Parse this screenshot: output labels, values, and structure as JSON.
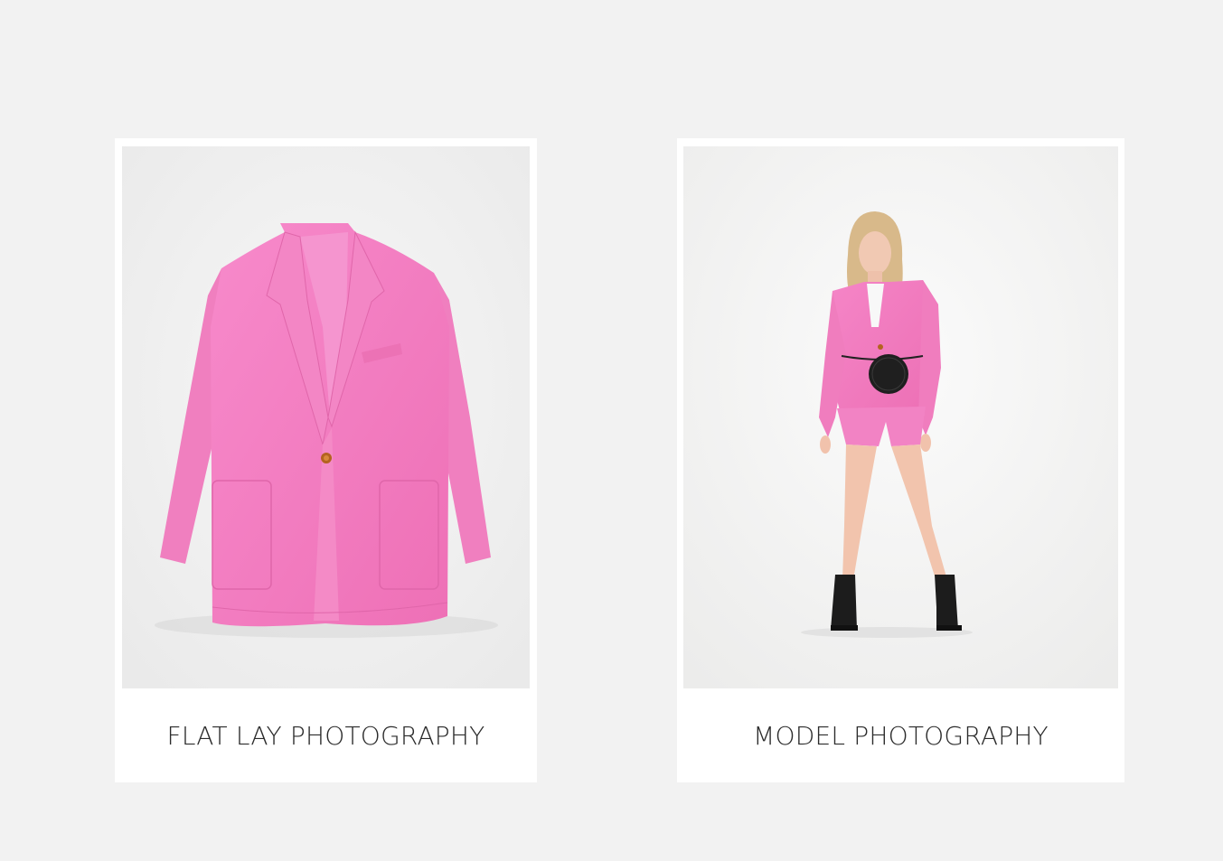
{
  "gallery": {
    "cards": [
      {
        "caption": "FLAT LAY PHOTOGRAPHY",
        "image_subject": "pink blazer flat lay"
      },
      {
        "caption": "MODEL PHOTOGRAPHY",
        "image_subject": "model in pink blazer and shorts"
      }
    ]
  },
  "colors": {
    "page_background": "#f2f2f2",
    "card_background": "#ffffff",
    "garment_pink": "#f37cc0",
    "caption_text": "#2b2b2b"
  }
}
